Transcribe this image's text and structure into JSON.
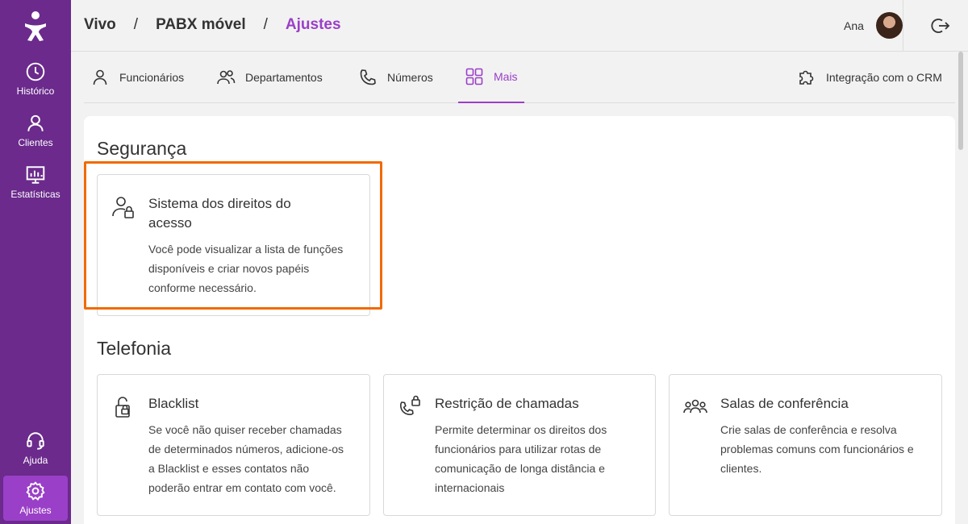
{
  "sidebar": {
    "items": [
      {
        "label": "Histórico",
        "icon": "clock-icon"
      },
      {
        "label": "Clientes",
        "icon": "person-icon"
      },
      {
        "label": "Estatísticas",
        "icon": "chart-icon"
      },
      {
        "label": "Ajuda",
        "icon": "headset-icon"
      },
      {
        "label": "Ajustes",
        "icon": "gear-icon"
      }
    ]
  },
  "header": {
    "breadcrumb": [
      "Vivo",
      "PABX móvel",
      "Ajustes"
    ],
    "separator": "/",
    "user_name": "Ana"
  },
  "tabs": [
    {
      "label": "Funcionários",
      "icon": "person-icon"
    },
    {
      "label": "Departamentos",
      "icon": "people-icon"
    },
    {
      "label": "Números",
      "icon": "phone-icon"
    },
    {
      "label": "Mais",
      "icon": "grid-icon"
    },
    {
      "label": "Integração com o CRM",
      "icon": "puzzle-icon"
    }
  ],
  "sections": {
    "security": {
      "title": "Segurança",
      "cards": [
        {
          "title_line1": "Sistema dos direitos do",
          "title_line2": "acesso",
          "desc": [
            "Você pode visualizar a lista de funções",
            "disponíveis e criar novos papéis",
            "conforme necessário."
          ]
        }
      ]
    },
    "telephony": {
      "title": "Telefonia",
      "cards": [
        {
          "title": "Blacklist",
          "desc": [
            "Se você não quiser receber chamadas",
            "de determinados números, adicione-os",
            "a Blacklist e esses contatos não",
            "poderão entrar em contato com você."
          ]
        },
        {
          "title": "Restrição de chamadas",
          "desc": [
            "Permite determinar os direitos dos",
            "funcionários para utilizar rotas de",
            "comunicação de longa distância e",
            "internacionais"
          ]
        },
        {
          "title": "Salas de conferência",
          "desc": [
            "Crie salas de conferência e resolva",
            "problemas comuns com funcionários e",
            "clientes."
          ]
        }
      ]
    }
  },
  "colors": {
    "brand": "#6b2a8c",
    "accent": "#9a3fc7",
    "highlight": "#f06a00"
  }
}
